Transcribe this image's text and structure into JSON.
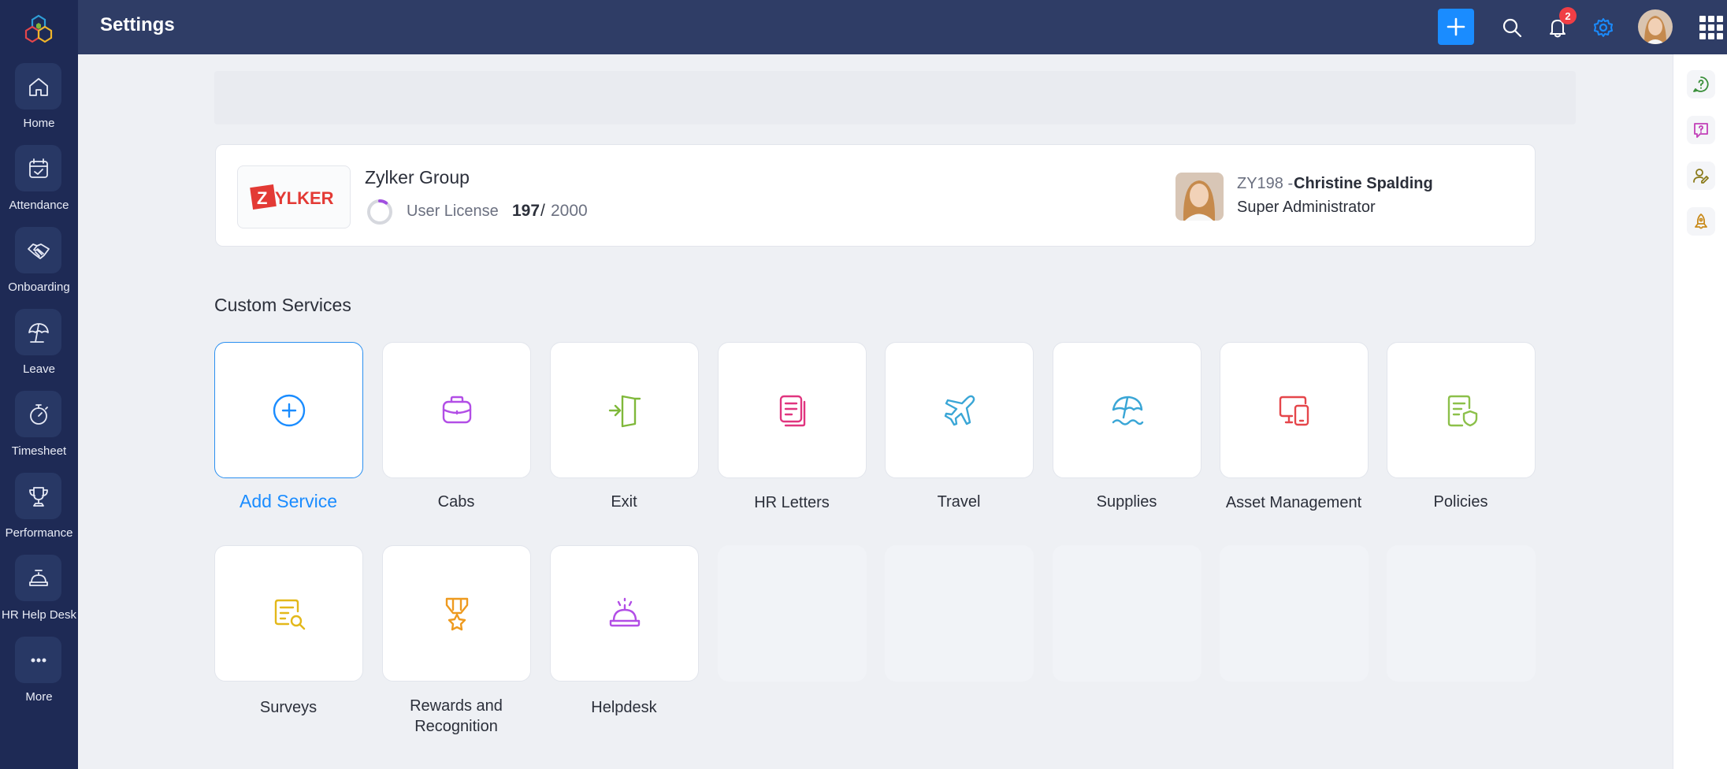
{
  "app": {
    "page_title": "Settings"
  },
  "sidebar": {
    "items": [
      {
        "label": "Home",
        "icon": "home-icon"
      },
      {
        "label": "Attendance",
        "icon": "calendar-check-icon"
      },
      {
        "label": "Onboarding",
        "icon": "handshake-icon"
      },
      {
        "label": "Leave",
        "icon": "umbrella-icon"
      },
      {
        "label": "Timesheet",
        "icon": "stopwatch-icon"
      },
      {
        "label": "Performance",
        "icon": "trophy-icon"
      },
      {
        "label": "HR Help Desk",
        "icon": "helpdesk-icon"
      },
      {
        "label": "More",
        "icon": "more-icon"
      }
    ]
  },
  "topbar": {
    "notification_count": "2",
    "accent_color": "#1a8cff"
  },
  "org": {
    "logo_text": "ZYLKER",
    "name": "Zylker Group",
    "license_label": "User License",
    "license_used": "197",
    "license_separator": "/",
    "license_total": "2000",
    "license_fraction": 0.0985
  },
  "admin": {
    "id_prefix": "ZY198 -",
    "name": "Christine Spalding",
    "role": "Super Administrator"
  },
  "custom_services": {
    "title": "Custom Services",
    "items": [
      {
        "label": "Add Service",
        "icon": "add-circle-icon",
        "color": "#1a8cff"
      },
      {
        "label": "Cabs",
        "icon": "briefcase-icon",
        "color": "#b24ee6"
      },
      {
        "label": "Exit",
        "icon": "exit-door-icon",
        "color": "#7fb83a"
      },
      {
        "label": "HR Letters",
        "icon": "documents-icon",
        "color": "#e0357f"
      },
      {
        "label": "Travel",
        "icon": "airplane-icon",
        "color": "#3aa6d6"
      },
      {
        "label": "Supplies",
        "icon": "beach-umbrella-icon",
        "color": "#3aa6d6"
      },
      {
        "label": "Asset Management",
        "icon": "devices-icon",
        "color": "#e5464b"
      },
      {
        "label": "Policies",
        "icon": "policy-shield-icon",
        "color": "#8cc04a"
      },
      {
        "label": "Surveys",
        "icon": "survey-icon",
        "color": "#e3b81a"
      },
      {
        "label": "Rewards and Recognition",
        "icon": "medal-icon",
        "color": "#ee9a1f"
      },
      {
        "label": "Helpdesk",
        "icon": "service-bell-icon",
        "color": "#b24ee6"
      }
    ]
  }
}
